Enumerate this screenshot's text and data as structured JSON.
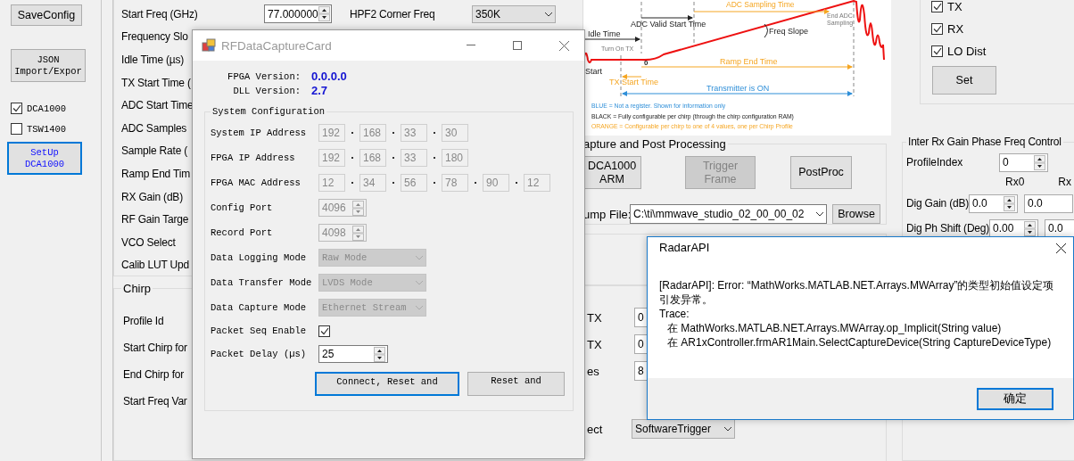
{
  "sidebar": {
    "save_button": "SaveConfig",
    "json_button": [
      "JSON",
      "Import/Expor"
    ],
    "devices": [
      {
        "label": "DCA1000",
        "checked": true
      },
      {
        "label": "TSW1400",
        "checked": false
      }
    ],
    "setup_button": [
      "SetUp",
      "DCA1000"
    ]
  },
  "profile": {
    "start_freq": {
      "label": "Start Freq (GHz)",
      "value": "77.000000"
    },
    "hpf2": {
      "label": "HPF2 Corner Freq",
      "value": "350K"
    },
    "labels": [
      "Frequency Slo",
      "Idle Time (µs)",
      "TX Start Time (",
      "ADC Start Time",
      "ADC Samples",
      "Sample Rate (",
      "Ramp End Tim",
      "RX Gain (dB)",
      "RF Gain Targe",
      "VCO Select",
      "Calib LUT Upd"
    ]
  },
  "chirp": {
    "title": "Chirp",
    "labels": [
      "Profile Id",
      "Start Chirp for",
      "End Chirp for",
      "Start Freq Var"
    ]
  },
  "diagram": {
    "adc_sampling_time": "ADC Sampling Time",
    "adc_valid_start_time": "ADC Valid Start Time",
    "idle_time": "Idle Time",
    "freq_slope": "Freq Slope",
    "end_adc_sampling": [
      "End ADC",
      "Sampling"
    ],
    "turn_on_tx": "Turn On TX",
    "zero": "0",
    "start": "Start",
    "ramp_end_time": "Ramp End Time",
    "tx_start_time": "TX Start Time",
    "transmitter_on": "Transmitter is ON",
    "legend": [
      {
        "text": "BLUE = Not a register. Shown for information only",
        "kind": "info"
      },
      {
        "text": "BLACK = Fully configurable per chirp (through the chirp configuration RAM)",
        "kind": "chirp"
      },
      {
        "text": "ORANGE = Configurable per chirp to one of 4 values, one per Chirp Profile",
        "kind": "profile"
      }
    ]
  },
  "capture": {
    "title": "apture and Post Processing",
    "buttons": [
      {
        "lines": [
          "DCA1000",
          "ARM"
        ],
        "disabled": false
      },
      {
        "lines": [
          "Trigger",
          "Frame"
        ],
        "disabled": true
      },
      {
        "lines": [
          "PostProc"
        ],
        "disabled": false
      }
    ],
    "dump_label": "ump File:",
    "dump_value": "C:\\ti\\mmwave_studio_02_00_00_02",
    "browse": "Browse"
  },
  "lower": {
    "rows": [
      {
        "label": "TX",
        "value": "0"
      },
      {
        "label": "TX",
        "value": "0"
      },
      {
        "label": "es",
        "value": "8"
      }
    ],
    "trigger_label": "ect",
    "trigger_value": "SoftwareTrigger"
  },
  "rf_checks": [
    {
      "label": "TX",
      "checked": true
    },
    {
      "label": "RX",
      "checked": true
    },
    {
      "label": "LO Dist",
      "checked": true
    }
  ],
  "rf_set": "Set",
  "rx_gain": {
    "title": "Inter Rx Gain Phase Freq Control",
    "profile_label": "ProfileIndex",
    "profile_value": "0",
    "columns": [
      "Rx0",
      "Rx"
    ],
    "rows": [
      {
        "label": "Dig Gain (dB)",
        "values": [
          "0.0",
          "0.0"
        ]
      },
      {
        "label": "Dig Ph Shift (Deg)",
        "values": [
          "0.00",
          "0.0"
        ]
      }
    ]
  },
  "capture_dialog": {
    "title": "RFDataCaptureCard",
    "versions": [
      {
        "label": "FPGA Version:",
        "value": "0.0.0.0"
      },
      {
        "label": "DLL Version:",
        "value": "2.7"
      }
    ],
    "group_title": "System Configuration",
    "rows": [
      {
        "kind": "octets",
        "label": "System IP Address",
        "values": [
          "192",
          "168",
          "33",
          "30"
        ]
      },
      {
        "kind": "octets",
        "label": "FPGA IP Address",
        "values": [
          "192",
          "168",
          "33",
          "180"
        ]
      },
      {
        "kind": "octets",
        "label": "FPGA MAC Address",
        "values": [
          "12",
          "34",
          "56",
          "78",
          "90",
          "12"
        ]
      },
      {
        "kind": "spin",
        "label": "Config Port",
        "value": "4096",
        "disabled": true
      },
      {
        "kind": "spin",
        "label": "Record Port",
        "value": "4098",
        "disabled": true
      },
      {
        "kind": "combo",
        "label": "Data Logging Mode",
        "value": "Raw Mode",
        "disabled": true
      },
      {
        "kind": "combo",
        "label": "Data Transfer Mode",
        "value": "LVDS Mode",
        "disabled": true
      },
      {
        "kind": "combo",
        "label": "Data Capture Mode",
        "value": "Ethernet Stream",
        "disabled": true
      },
      {
        "kind": "check",
        "label": "Packet Seq Enable",
        "checked": true
      },
      {
        "kind": "spin",
        "label": "Packet Delay (µs)",
        "value": "25",
        "disabled": false
      }
    ],
    "buttons": [
      {
        "label": "Connect, Reset and",
        "focused": true
      },
      {
        "label": "Reset and",
        "focused": false
      }
    ]
  },
  "error_dialog": {
    "title": "RadarAPI",
    "message": "[RadarAPI]: Error: “MathWorks.MATLAB.NET.Arrays.MWArray”的类型初始值设定项引发异常。",
    "trace_label": "Trace:",
    "trace": [
      "在 MathWorks.MATLAB.NET.Arrays.MWArray.op_Implicit(String value)",
      "在 AR1xController.frmAR1Main.SelectCaptureDevice(String CaptureDeviceType)"
    ],
    "ok": "确定"
  }
}
